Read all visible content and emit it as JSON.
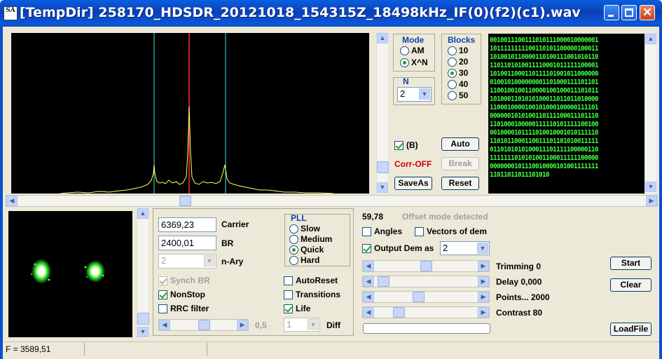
{
  "window": {
    "title": "[TempDir] 258170_HDSDR_20121018_154315Z_18498kHz_IF(0)(f2)(c1).wav",
    "icon": "SA"
  },
  "mode": {
    "title": "Mode",
    "options": [
      "AM",
      "X^N"
    ],
    "selected": "X^N"
  },
  "blocks": {
    "title": "Blocks",
    "options": [
      "10",
      "20",
      "30",
      "40",
      "50"
    ],
    "selected": "30"
  },
  "n": {
    "title": "N",
    "value": "2"
  },
  "buttons": {
    "auto": "Auto",
    "break": "Break",
    "saveas": "SaveAs",
    "reset": "Reset",
    "start": "Start",
    "clear": "Clear",
    "loadfile": "LoadFile"
  },
  "checks": {
    "b_label": "(B)",
    "b_checked": true,
    "angles": "Angles",
    "vectors": "Vectors of dem",
    "output_dem": "Output Dem as",
    "synch_br": "Synch BR",
    "nonstop": "NonStop",
    "rrc": "RRC filter",
    "autoreset": "AutoReset",
    "transitions": "Transitions",
    "life": "Life"
  },
  "corr": {
    "text": "Corr-OFF",
    "color": "#cc0000"
  },
  "bits": [
    "0010011100111010111000010000001",
    "1011111111100110101100000100011",
    "1010010110000110100111001010110",
    "1101101010011110001011111100001",
    "1010011000110111101001011000000",
    "0100101000000001101000111101101",
    "1100100100110000100100011101011",
    "1010001101010100011011011010000",
    "1100010000100101000100000111101",
    "0000001010100110111100011101110",
    "1101000100000111110101111100100",
    "0010000101111010010001010111110",
    "1101011000110011101101010011111",
    "0110101010100011101111100000110",
    "1111111010101001100011111100000",
    "0000000101110010000101001111111",
    "11011011011101010"
  ],
  "carrier": {
    "value": "6369,23",
    "label": "Carrier"
  },
  "br": {
    "value": "2400,01",
    "label": "BR"
  },
  "nary": {
    "value": "2",
    "label": "n-Ary"
  },
  "pll": {
    "title": "PLL",
    "options": [
      "Slow",
      "Medium",
      "Quick",
      "Hard"
    ],
    "selected": "Quick"
  },
  "slider_value": "0,5",
  "diff": {
    "value": "1",
    "label": "Diff"
  },
  "rate": "59,78",
  "offset_mode": "Offset mode detected",
  "output_dem_value": "2",
  "sliders": {
    "trimming": "Trimming 0",
    "delay": "Delay  0,000",
    "points": "Points... 2000",
    "contrast": "Contrast 80"
  },
  "status": {
    "frequency": "F = 3589,51"
  },
  "colors": {
    "titlebar": "#0a4fc8",
    "spectrum_bg": "#000000",
    "spectrum_line": "#ffff66",
    "marker_center": "#ff3030",
    "marker_side": "#40e0e0",
    "bits_text": "#40ff40",
    "constellation": "#40ff40"
  }
}
